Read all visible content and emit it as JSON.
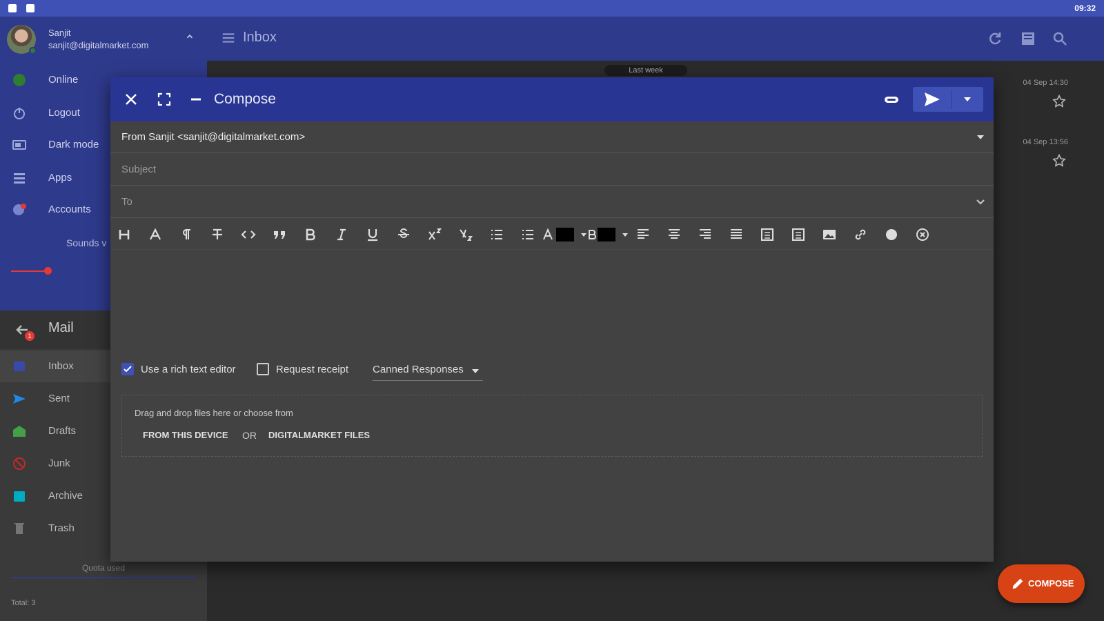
{
  "status_bar": {
    "time": "09:32"
  },
  "account": {
    "name": "Sanjit",
    "email": "sanjit@digitalmarket.com"
  },
  "side_menu": [
    {
      "label": "Online",
      "icon": "online-status-icon"
    },
    {
      "label": "Logout",
      "icon": "power-icon"
    },
    {
      "label": "Dark mode",
      "icon": "dark-mode-icon"
    },
    {
      "label": "Apps",
      "icon": "apps-icon"
    },
    {
      "label": "Accounts",
      "icon": "accounts-icon"
    }
  ],
  "sounds_label": "Sounds v",
  "mail": {
    "title": "Mail",
    "badge": "1"
  },
  "folders": [
    {
      "label": "Inbox",
      "icon": "inbox-icon"
    },
    {
      "label": "Sent",
      "icon": "send-icon"
    },
    {
      "label": "Drafts",
      "icon": "drafts-icon"
    },
    {
      "label": "Junk",
      "icon": "junk-icon"
    },
    {
      "label": "Archive",
      "icon": "archive-icon"
    },
    {
      "label": "Trash",
      "icon": "trash-icon"
    }
  ],
  "quota": {
    "label": "Quota used"
  },
  "total": "Total: 3",
  "topbar": {
    "title": "Inbox"
  },
  "list": {
    "date_chip": "Last week",
    "messages": [
      {
        "date": "04 Sep 14:30"
      },
      {
        "date": "04 Sep 13:56"
      }
    ]
  },
  "compose": {
    "title": "Compose",
    "from": "From Sanjit <sanjit@digitalmarket.com>",
    "subject_placeholder": "Subject",
    "to_placeholder": "To",
    "rich_text_label": "Use a rich text editor",
    "receipt_label": "Request receipt",
    "canned_label": "Canned Responses",
    "drop_text": "Drag and drop files here or choose from",
    "from_device": "FROM THIS DEVICE",
    "or": "OR",
    "from_files": "DIGITALMARKET FILES"
  },
  "fab": {
    "label": "COMPOSE"
  },
  "colors": {
    "primary": "#3f51b5",
    "primary_dark": "#283593",
    "accent": "#d84315",
    "background": "#303030"
  }
}
